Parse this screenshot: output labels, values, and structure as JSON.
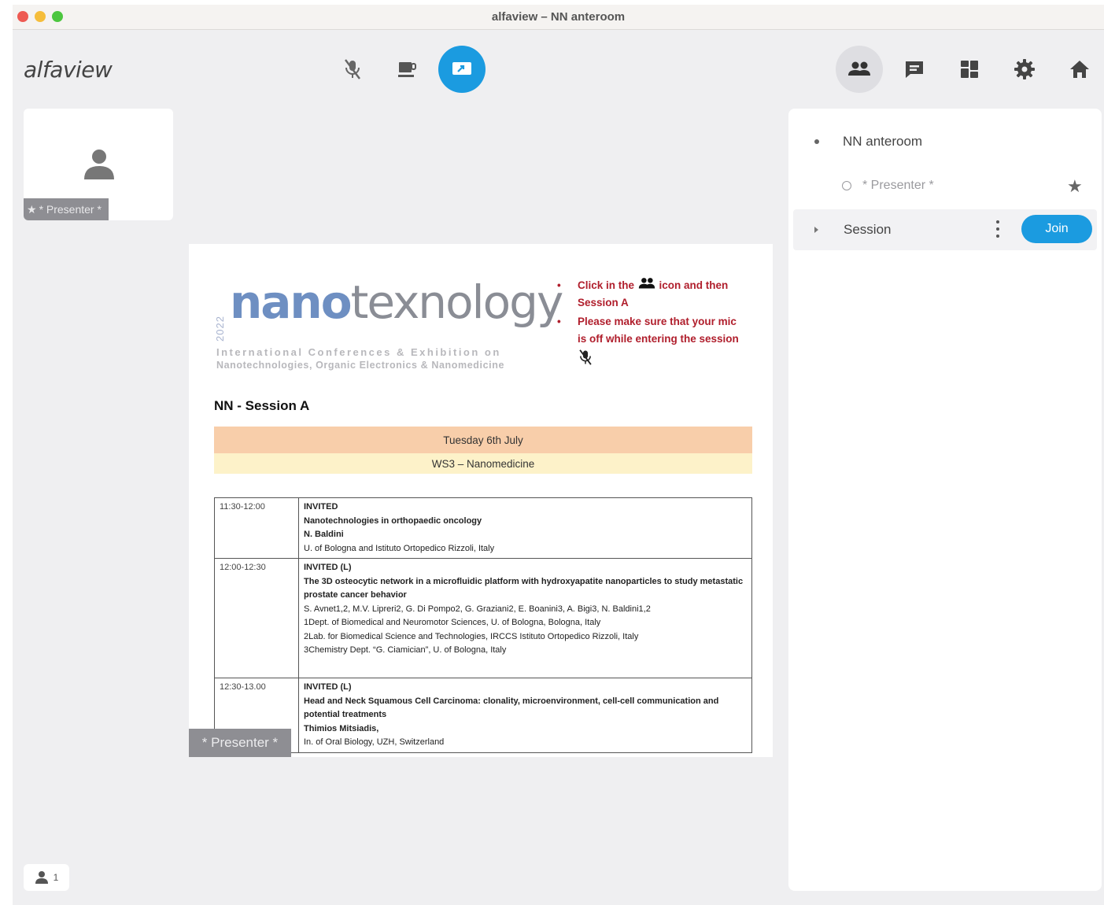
{
  "window": {
    "title": "alfaview – NN anteroom"
  },
  "app": {
    "logo": "alfaview"
  },
  "toolbar": {
    "left": [
      {
        "name": "mic-muted-icon"
      },
      {
        "name": "coffee-break-icon"
      },
      {
        "name": "screen-share-icon",
        "active": true
      }
    ],
    "right": [
      {
        "name": "people-icon",
        "active": true
      },
      {
        "name": "chat-icon"
      },
      {
        "name": "layout-grid-icon"
      },
      {
        "name": "settings-gear-icon"
      },
      {
        "name": "home-icon"
      }
    ]
  },
  "self_tile": {
    "label": "* Presenter *"
  },
  "shared_screen": {
    "presenter_label": "* Presenter *",
    "logo": {
      "year": "2022",
      "word_highlight": "nano",
      "word_rest": "texnology",
      "subtitle1": "International Conferences & Exhibition on",
      "subtitle2": "Nanotechnologies, Organic Electronics & Nanomedicine"
    },
    "instructions": {
      "item1_before": "Click in the",
      "item1_after": "icon and then Session A",
      "item2": "Please make sure that your mic is off while entering the session"
    },
    "session_title": "NN - Session A",
    "date_band": "Tuesday 6th July",
    "ws_band": "WS3 – Nanomedicine",
    "schedule": [
      {
        "time": "11:30-12:00",
        "lines": [
          {
            "text": "INVITED",
            "bold": true
          },
          {
            "text": "Nanotechnologies in orthopaedic oncology",
            "bold": true
          },
          {
            "text": "N. Baldini",
            "bold": true
          },
          {
            "text": "U. of Bologna and Istituto Ortopedico Rizzoli, Italy",
            "bold": false
          }
        ]
      },
      {
        "time": "12:00-12:30",
        "lines": [
          {
            "text": "INVITED (L)",
            "bold": true
          },
          {
            "text": "The 3D osteocytic network in a microfluidic platform with hydroxyapatite nanoparticles to study metastatic prostate cancer behavior",
            "bold": true
          },
          {
            "text": "S. Avnet1,2, M.V. Lipreri2, G. Di Pompo2, G. Graziani2, E. Boanini3, A. Bigi3, N. Baldini1,2",
            "bold": false
          },
          {
            "text": "1Dept. of Biomedical and Neuromotor Sciences, U. of Bologna, Bologna, Italy",
            "bold": false
          },
          {
            "text": "2Lab. for Biomedical Science and Technologies, IRCCS Istituto Ortopedico Rizzoli, Italy",
            "bold": false
          },
          {
            "text": "3Chemistry Dept. “G. Ciamician”, U. of Bologna, Italy",
            "bold": false
          }
        ]
      },
      {
        "time": "12:30-13.00",
        "lines": [
          {
            "text": "INVITED (L)",
            "bold": true
          },
          {
            "text": "Head and Neck Squamous Cell Carcinoma: clonality, microenvironment, cell-cell communication and potential treatments",
            "bold": true
          },
          {
            "text": "Thimios Mitsiadis,",
            "bold": true
          },
          {
            "text": "In. of Oral Biology, UZH, Switzerland",
            "bold": false
          }
        ]
      }
    ]
  },
  "sidebar": {
    "room_name": "NN anteroom",
    "presenter": "* Presenter *",
    "session_name": "Session",
    "join_label": "Join"
  },
  "footer": {
    "user_count": "1"
  },
  "colors": {
    "accent": "#1b9be0",
    "instruction_red": "#b01e2c"
  }
}
